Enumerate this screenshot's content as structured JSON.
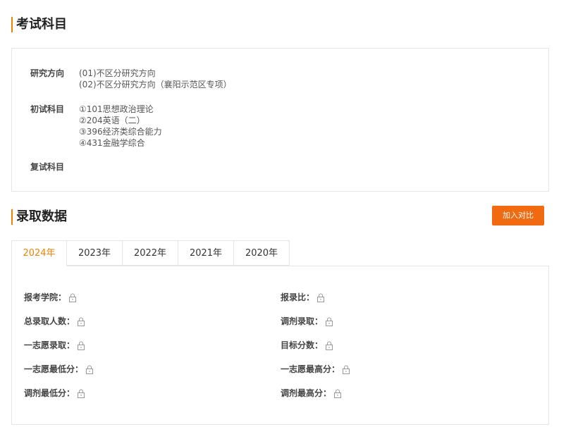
{
  "subjects": {
    "title": "考试科目",
    "research": {
      "label": "研究方向",
      "items": [
        "(01)不区分研究方向",
        "(02)不区分研究方向（襄阳示范区专项）"
      ]
    },
    "initial": {
      "label": "初试科目",
      "items": [
        "①101思想政治理论",
        "②204英语（二）",
        "③396经济类综合能力",
        "④431金融学综合"
      ]
    },
    "retest": {
      "label": "复试科目"
    }
  },
  "admission": {
    "title": "录取数据",
    "compare_button": "加入对比",
    "tabs": [
      "2024年",
      "2023年",
      "2022年",
      "2021年",
      "2020年"
    ],
    "active_tab": "2024年",
    "fields": {
      "college": "报考学院：",
      "ratio": "报录比：",
      "total_admitted": "总录取人数：",
      "transfer_admitted": "调剂录取：",
      "first_choice_admitted": "一志愿录取：",
      "target_score": "目标分数：",
      "first_choice_min": "一志愿最低分：",
      "first_choice_max": "一志愿最高分：",
      "transfer_min": "调剂最低分：",
      "transfer_max": "调剂最高分："
    },
    "lock_icon": "lock-icon",
    "accent_color": "#f08200",
    "button_color": "#f26a10"
  }
}
